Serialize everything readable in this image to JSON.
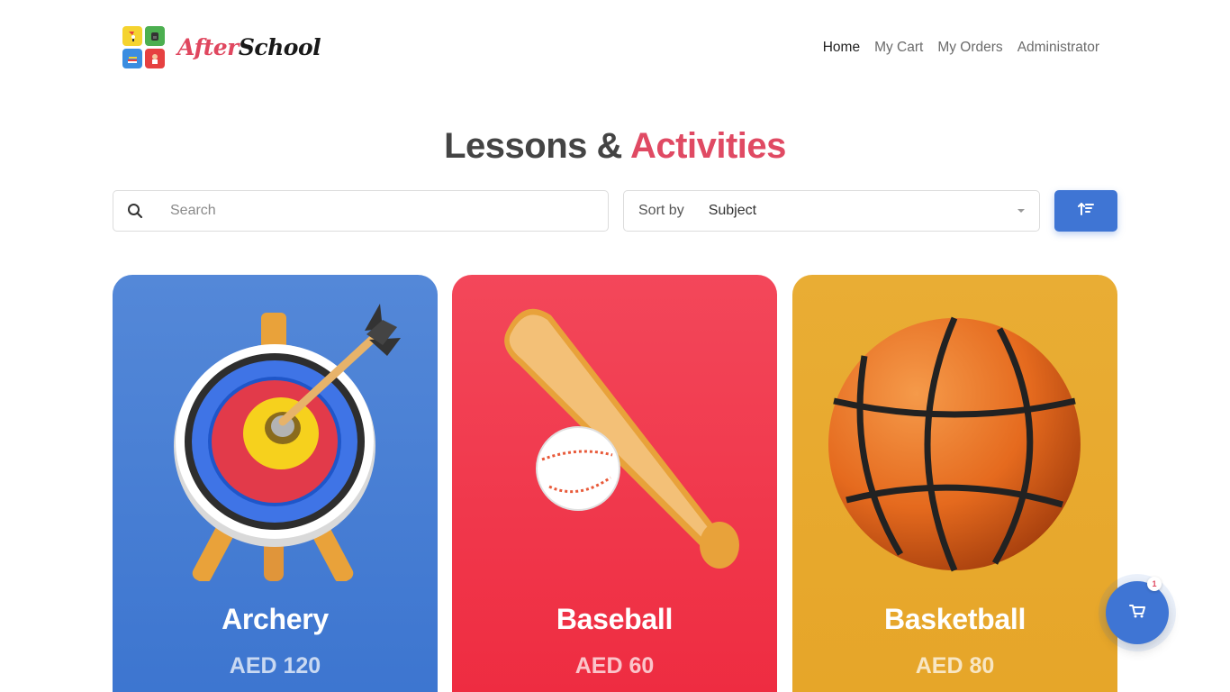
{
  "logo": {
    "text_after": "After",
    "text_school": "School",
    "tile_icons": [
      "kid-kite-icon",
      "backpack-icon",
      "books-icon",
      "kid-icon"
    ]
  },
  "nav": {
    "items": [
      {
        "label": "Home",
        "active": true
      },
      {
        "label": "My Cart",
        "active": false
      },
      {
        "label": "My Orders",
        "active": false
      },
      {
        "label": "Administrator",
        "active": false
      }
    ]
  },
  "title": {
    "main": "Lessons &",
    "accent": "Activities"
  },
  "search": {
    "placeholder": "Search",
    "value": "",
    "icon": "search-icon"
  },
  "sort": {
    "label": "Sort by",
    "selected": "Subject",
    "icon": "chevron-down-icon"
  },
  "order_button": {
    "icon": "sort-ascending-icon"
  },
  "cards": [
    {
      "name": "Archery",
      "price": "AED 120",
      "image": "archery-target-icon",
      "color": "#4a7fd6"
    },
    {
      "name": "Baseball",
      "price": "AED 60",
      "image": "baseball-bat-ball-icon",
      "color": "#f03a4e"
    },
    {
      "name": "Basketball",
      "price": "AED 80",
      "image": "basketball-icon",
      "color": "#e8aa2e"
    }
  ],
  "cart_fab": {
    "count": "1",
    "icon": "cart-icon"
  },
  "colors": {
    "accent": "#e04a63",
    "primary": "#3f75d4"
  }
}
